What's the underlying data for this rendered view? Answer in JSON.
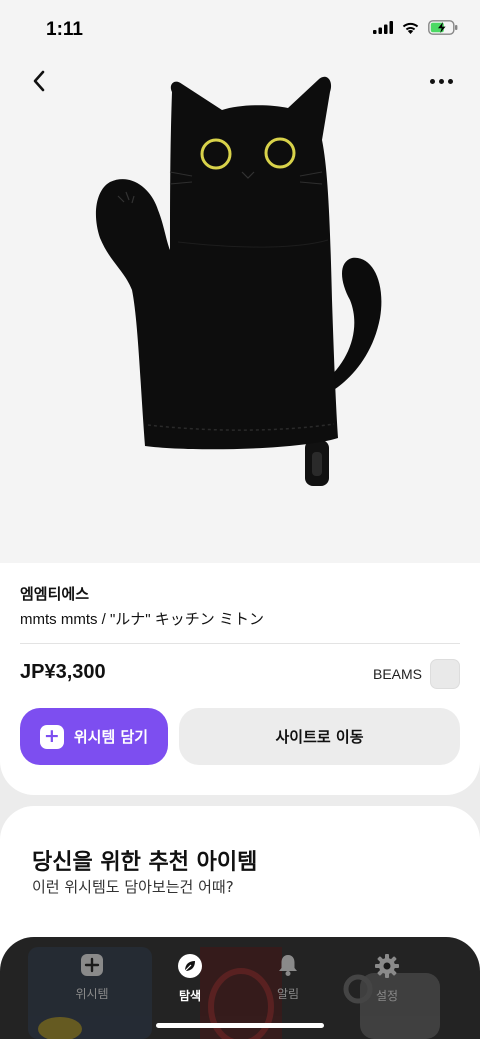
{
  "status_bar": {
    "time": "1:11"
  },
  "product": {
    "brand": "엠엠티에스",
    "name": "mmts mmts / \"ルナ\" キッチン ミトン",
    "price": "JP¥3,300",
    "shop": "BEAMS"
  },
  "actions": {
    "wishlist_label": "위시템 담기",
    "site_label": "사이트로 이동"
  },
  "recommend": {
    "title": "당신을 위한 추천 아이템",
    "subtitle": "이런 위시템도 담아보는건 어때?"
  },
  "tabs": [
    {
      "label": "위시템",
      "icon": "plus-square-icon",
      "active": false
    },
    {
      "label": "탐색",
      "icon": "leaf-icon",
      "active": true
    },
    {
      "label": "알림",
      "icon": "bell-icon",
      "active": false
    },
    {
      "label": "설정",
      "icon": "gear-icon",
      "active": false
    }
  ],
  "colors": {
    "accent": "#7d4ef0",
    "tabbar": "#121212",
    "mitt": "#0d0d0d",
    "eyes": "#d8d24a"
  }
}
